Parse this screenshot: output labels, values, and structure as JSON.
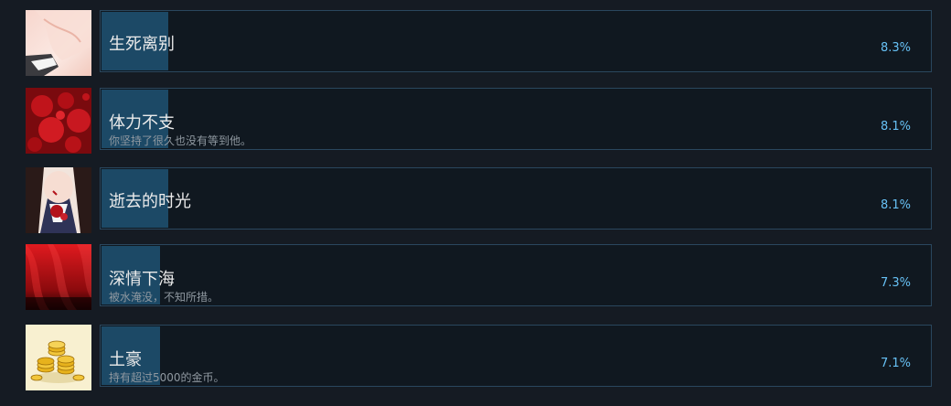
{
  "achievements": [
    {
      "title": "生死离别",
      "description": "",
      "percent": "8.3%",
      "icon": "pale-sleeve-icon",
      "progress": 0.083
    },
    {
      "title": "体力不支",
      "description": "你坚持了很久也没有等到他。",
      "percent": "8.1%",
      "icon": "blood-splatter-icon",
      "progress": 0.081
    },
    {
      "title": "逝去的时光",
      "description": "",
      "percent": "8.1%",
      "icon": "bloodied-girl-icon",
      "progress": 0.081
    },
    {
      "title": "深情下海",
      "description": "被水淹没，不知所措。",
      "percent": "7.3%",
      "icon": "red-curtain-icon",
      "progress": 0.073
    },
    {
      "title": "土豪",
      "description": "持有超过5000的金币。",
      "percent": "7.1%",
      "icon": "gold-coins-icon",
      "progress": 0.071
    }
  ],
  "colors": {
    "progress_fill": "#1c4966",
    "percent_text": "#67c1f5",
    "title_text": "#ebebeb",
    "description_text": "#8f98a0",
    "card_border": "#2a475e"
  }
}
